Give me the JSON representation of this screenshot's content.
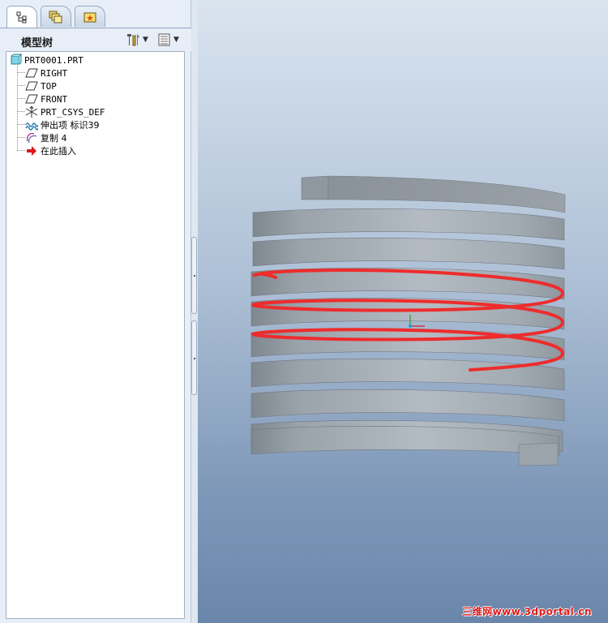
{
  "tabs": [
    {
      "name": "model-tree",
      "icon": "model-tree-icon",
      "active": true
    },
    {
      "name": "layers",
      "icon": "layers-icon",
      "active": false
    },
    {
      "name": "favorites",
      "icon": "favorites-icon",
      "active": false
    }
  ],
  "panel": {
    "title": "模型树",
    "settings_icon": "tree-settings-icon",
    "show_icon": "tree-show-icon"
  },
  "tree": {
    "root": {
      "label": "PRT0001.PRT",
      "icon": "part-icon"
    },
    "items": [
      {
        "label": "RIGHT",
        "icon": "datum-plane-icon"
      },
      {
        "label": "TOP",
        "icon": "datum-plane-icon"
      },
      {
        "label": "FRONT",
        "icon": "datum-plane-icon"
      },
      {
        "label": "PRT_CSYS_DEF",
        "icon": "csys-icon"
      },
      {
        "label": "伸出项 标识39",
        "icon": "protrusion-icon"
      },
      {
        "label": "复制 4",
        "icon": "copy-curve-icon"
      },
      {
        "label": "在此插入",
        "icon": "insert-here-arrow-icon"
      }
    ]
  },
  "viewport": {
    "watermark": "三维网www.3dportal.cn",
    "colors": {
      "coil": "#9aa3ab",
      "helix_curve": "#ee2c2c",
      "background_top": "#d9e4ef",
      "background_bottom": "#6a86aa"
    }
  }
}
